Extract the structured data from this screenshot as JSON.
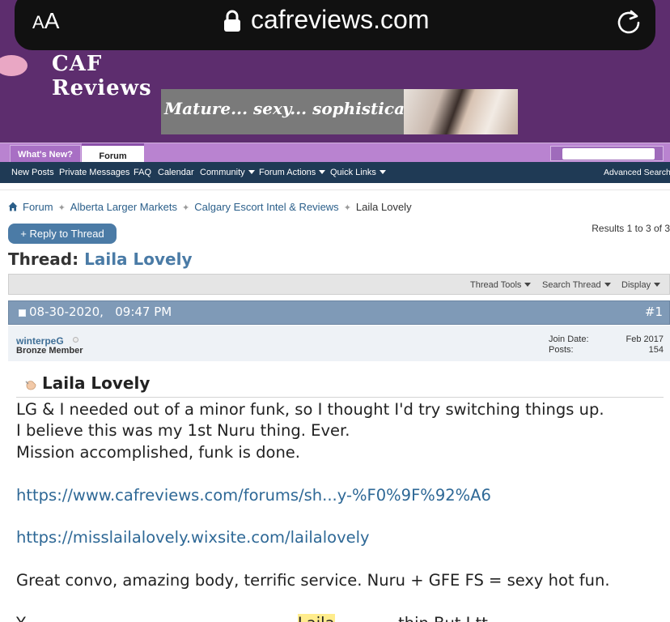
{
  "browser": {
    "text_size_label_small": "A",
    "text_size_label_large": "A",
    "url": "cafreviews.com"
  },
  "header": {
    "logo_text": "CAF Reviews",
    "ad_text": "Mature... sexy... sophisticated..."
  },
  "tabs": {
    "whats_new": "What's New?",
    "forum": "Forum"
  },
  "sub_nav": {
    "items": [
      "New Posts",
      "Private Messages",
      "FAQ",
      "Calendar",
      "Community",
      "Forum Actions",
      "Quick Links"
    ],
    "advanced_search": "Advanced Search"
  },
  "breadcrumb": {
    "items": [
      "Forum",
      "Alberta Larger Markets",
      "Calgary Escort Intel & Reviews"
    ],
    "current": "Laila Lovely"
  },
  "thread": {
    "reply_button": "+ Reply to Thread",
    "results": "Results 1 to 3 of 3",
    "title_prefix": "Thread:",
    "title_name": "Laila Lovely",
    "tools": [
      "Thread Tools",
      "Search Thread",
      "Display"
    ]
  },
  "post": {
    "date": "08-30-2020,   09:47 PM",
    "number": "#1",
    "username": "winterpeG",
    "rank": "Bronze Member",
    "join_date_label": "Join Date:",
    "join_date_value": "Feb 2017",
    "posts_label": "Posts:",
    "posts_value": "154",
    "title": "Laila Lovely",
    "lines": [
      "LG & I needed out of a minor funk, so I thought I'd try switching things up.",
      "I believe this was my 1st Nuru thing. Ever.",
      "Mission accomplished, funk is done."
    ],
    "link_1": "https://www.cafreviews.com/forums/sh...y-%F0%9F%92%A6",
    "link_2": "https://misslailalovely.wixsite.com/lailalovely",
    "summary": "Great convo, amazing body, terrific service. Nuru + GFE FS = sexy hot fun.",
    "cut_line_start": "Y",
    "cut_line_highlight": "Laila",
    "cut_line_end": "...thin  But I  tt"
  }
}
